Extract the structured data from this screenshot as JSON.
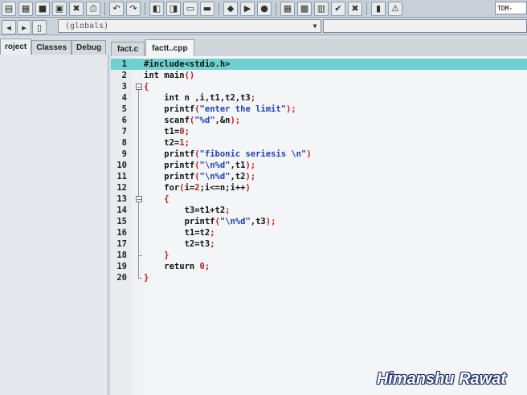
{
  "toolbar": {
    "buttons": [
      {
        "name": "new-file-icon",
        "glyph": "▤"
      },
      {
        "name": "open-icon",
        "glyph": "▦"
      },
      {
        "name": "save-icon",
        "glyph": "■"
      },
      {
        "name": "save-all-icon",
        "glyph": "▣"
      },
      {
        "name": "close-file-icon",
        "glyph": "✖"
      },
      {
        "name": "print-icon",
        "glyph": "⎙"
      },
      {
        "name": "undo-icon",
        "glyph": "↶"
      },
      {
        "name": "redo-icon",
        "glyph": "↷"
      },
      {
        "name": "find-icon",
        "glyph": "◧"
      },
      {
        "name": "replace-icon",
        "glyph": "◨"
      },
      {
        "name": "goto-icon",
        "glyph": "▭"
      },
      {
        "name": "bookmark-icon",
        "glyph": "▬"
      },
      {
        "name": "compile-icon",
        "glyph": "◆"
      },
      {
        "name": "run-icon",
        "glyph": "▶"
      },
      {
        "name": "debug-icon",
        "glyph": "●"
      },
      {
        "name": "grid-icon",
        "glyph": "▦"
      },
      {
        "name": "class-icon",
        "glyph": "▩"
      },
      {
        "name": "options-icon",
        "glyph": "▥"
      },
      {
        "name": "check-icon",
        "glyph": "✔"
      },
      {
        "name": "stop-icon",
        "glyph": "✖"
      },
      {
        "name": "chart-icon",
        "glyph": "▮"
      },
      {
        "name": "alert-icon",
        "glyph": "⚠"
      }
    ],
    "combo_text": "TDM-"
  },
  "scope": {
    "value": "(globals)"
  },
  "left_tabs": [
    "roject",
    "Classes",
    "Debug"
  ],
  "editor_tabs": [
    "fact.c",
    "factt..cpp"
  ],
  "code_lines": [
    {
      "n": "1",
      "tokens": [
        [
          "#include<stdio.h>",
          "kw"
        ]
      ],
      "highlight": true
    },
    {
      "n": "2",
      "tokens": [
        [
          "int main",
          "kw"
        ],
        [
          "()",
          "red"
        ]
      ]
    },
    {
      "n": "3",
      "tokens": [
        [
          "{",
          "red"
        ]
      ]
    },
    {
      "n": "4",
      "tokens": [
        [
          "    int n ,i,t1,t2,t3",
          "kw"
        ],
        [
          ";",
          "red"
        ]
      ]
    },
    {
      "n": "5",
      "tokens": [
        [
          "    printf",
          "kw"
        ],
        [
          "(",
          "red"
        ],
        [
          "\"enter the limit\"",
          "str"
        ],
        [
          ");",
          "red"
        ]
      ]
    },
    {
      "n": "6",
      "tokens": [
        [
          "    scanf",
          "kw"
        ],
        [
          "(",
          "red"
        ],
        [
          "\"%d\"",
          "str"
        ],
        [
          ",&n",
          "kw"
        ],
        [
          ");",
          "red"
        ]
      ]
    },
    {
      "n": "7",
      "tokens": [
        [
          "    t1=",
          "kw"
        ],
        [
          "0",
          "num"
        ],
        [
          ";",
          "red"
        ]
      ]
    },
    {
      "n": "8",
      "tokens": [
        [
          "    t2=",
          "kw"
        ],
        [
          "1",
          "num"
        ],
        [
          ";",
          "red"
        ]
      ]
    },
    {
      "n": "9",
      "tokens": [
        [
          "    printf",
          "kw"
        ],
        [
          "(",
          "red"
        ],
        [
          "\"fibonic seriesis \\n\"",
          "str"
        ],
        [
          ")",
          "red"
        ]
      ]
    },
    {
      "n": "10",
      "tokens": [
        [
          "    printf",
          "kw"
        ],
        [
          "(",
          "red"
        ],
        [
          "\"\\n%d\"",
          "str"
        ],
        [
          ",t1",
          "kw"
        ],
        [
          ");",
          "red"
        ]
      ]
    },
    {
      "n": "11",
      "tokens": [
        [
          "    printf",
          "kw"
        ],
        [
          "(",
          "red"
        ],
        [
          "\"\\n%d\"",
          "str"
        ],
        [
          ",t2",
          "kw"
        ],
        [
          ");",
          "red"
        ]
      ]
    },
    {
      "n": "12",
      "tokens": [
        [
          "    for",
          "kw"
        ],
        [
          "(",
          "red"
        ],
        [
          "i=",
          "kw"
        ],
        [
          "2",
          "num"
        ],
        [
          ";i<=n;i++",
          "kw"
        ],
        [
          ")",
          "red"
        ]
      ]
    },
    {
      "n": "13",
      "tokens": [
        [
          "    {",
          "red"
        ]
      ]
    },
    {
      "n": "14",
      "tokens": [
        [
          "        t3=t1+t2",
          "kw"
        ],
        [
          ";",
          "red"
        ]
      ]
    },
    {
      "n": "15",
      "tokens": [
        [
          "        printf",
          "kw"
        ],
        [
          "(",
          "red"
        ],
        [
          "\"\\n%d\"",
          "str"
        ],
        [
          ",t3",
          "kw"
        ],
        [
          ");",
          "red"
        ]
      ]
    },
    {
      "n": "16",
      "tokens": [
        [
          "        t1=t2",
          "kw"
        ],
        [
          ";",
          "red"
        ]
      ]
    },
    {
      "n": "17",
      "tokens": [
        [
          "        t2=t3",
          "kw"
        ],
        [
          ";",
          "red"
        ]
      ]
    },
    {
      "n": "18",
      "tokens": [
        [
          "    }",
          "red"
        ]
      ]
    },
    {
      "n": "19",
      "tokens": [
        [
          "    return ",
          "kw"
        ],
        [
          "0",
          "num"
        ],
        [
          ";",
          "red"
        ]
      ]
    },
    {
      "n": "20",
      "tokens": [
        [
          "}",
          "red"
        ]
      ]
    }
  ],
  "watermark": "Himanshu Rawat"
}
